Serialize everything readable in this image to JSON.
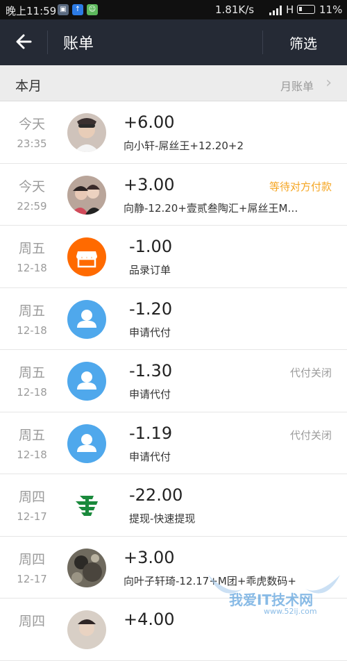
{
  "statusbar": {
    "time": "晚上11:59",
    "speed": "1.81K/s",
    "network": "H",
    "battery": "11%"
  },
  "navbar": {
    "title": "账单",
    "filter_label": "筛选"
  },
  "month_bar": {
    "label": "本月",
    "link": "月账单"
  },
  "transactions": [
    {
      "day": "今天",
      "date": "23:35",
      "amount": "+6.00",
      "desc": "向小轩-屌丝王+12.20+2",
      "status": "",
      "avatar": "photo"
    },
    {
      "day": "今天",
      "date": "22:59",
      "amount": "+3.00",
      "desc": "向静-12.20+壹贰叁陶汇+屌丝王M…",
      "status": "等待对方付款",
      "avatar": "photo"
    },
    {
      "day": "周五",
      "date": "12-18",
      "amount": "-1.00",
      "desc": "品录订单",
      "status": "",
      "avatar": "shop-icon"
    },
    {
      "day": "周五",
      "date": "12-18",
      "amount": "-1.20",
      "desc": "申请代付",
      "status": "",
      "avatar": "user-icon"
    },
    {
      "day": "周五",
      "date": "12-18",
      "amount": "-1.30",
      "desc": "申请代付",
      "status": "代付关闭",
      "avatar": "user-icon"
    },
    {
      "day": "周五",
      "date": "12-18",
      "amount": "-1.19",
      "desc": "申请代付",
      "status": "代付关闭",
      "avatar": "user-icon"
    },
    {
      "day": "周四",
      "date": "12-17",
      "amount": "-22.00",
      "desc": "提现-快速提现",
      "status": "",
      "avatar": "postal-icon"
    },
    {
      "day": "周四",
      "date": "12-17",
      "amount": "+3.00",
      "desc": "向叶子轩琦-12.17+M团+乖虎数码+",
      "status": "",
      "avatar": "photo"
    },
    {
      "day": "周四",
      "date": "",
      "amount": "+4.00",
      "desc": "",
      "status": "",
      "avatar": "photo"
    }
  ],
  "colors": {
    "status_pending": "#f5a623",
    "status_closed": "#9b9b9b",
    "shop_orange": "#ff6a00",
    "user_blue": "#4fa8ec",
    "postal_green": "#1a8a3c"
  },
  "watermark": {
    "text": "我爱IT技术网",
    "sub": "www.52ij.com"
  }
}
